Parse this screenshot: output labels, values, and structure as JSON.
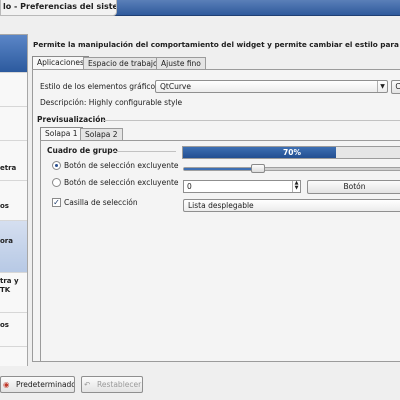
{
  "window": {
    "title": "lo - Preferencias del sistema"
  },
  "sidebar": {
    "items": [
      {
        "lines": [
          ""
        ],
        "selected": true
      },
      {
        "lines": [
          ""
        ]
      },
      {
        "lines": [
          ""
        ]
      },
      {
        "lines": [
          "etra"
        ]
      },
      {
        "lines": [
          "os"
        ]
      },
      {
        "lines": [
          "",
          "ora"
        ]
      },
      {
        "lines": [
          "tra y",
          "TK"
        ]
      },
      {
        "lines": [
          "os"
        ]
      },
      {
        "lines": [
          ""
        ]
      }
    ]
  },
  "page": {
    "description": "Permite la manipulación del comportamiento del widget y permite cambiar el estilo para KDE"
  },
  "tabs": [
    {
      "label": "Aplicaciones",
      "active": true
    },
    {
      "label": "Espacio de trabajo",
      "active": false
    },
    {
      "label": "Ajuste fino",
      "active": false
    }
  ],
  "style_settings": {
    "label": "Estilo de los elementos gráficos:",
    "value": "QtCurve",
    "configure_button": "C",
    "description": "Descripción: Highly configurable style"
  },
  "preview": {
    "heading": "Previsualización",
    "tabs": [
      {
        "label": "Solapa 1",
        "active": true
      },
      {
        "label": "Solapa 2",
        "active": false
      }
    ],
    "group_title": "Cuadro de grupo",
    "radio1": "Botón de selección excluyente",
    "radio2": "Botón de selección excluyente",
    "checkbox": "Casilla de selección",
    "progress_value": 0.7,
    "progress_text": "70%",
    "slider_value": 0.35,
    "spin_value": "0",
    "button_label": "Botón",
    "dropdown_value": "Lista desplegable"
  },
  "bottom": {
    "default_button": "Predeterminado",
    "reset_button": "Restablecer"
  },
  "icons": {
    "default": "lifebuoy-icon",
    "reset": "undo-icon"
  }
}
